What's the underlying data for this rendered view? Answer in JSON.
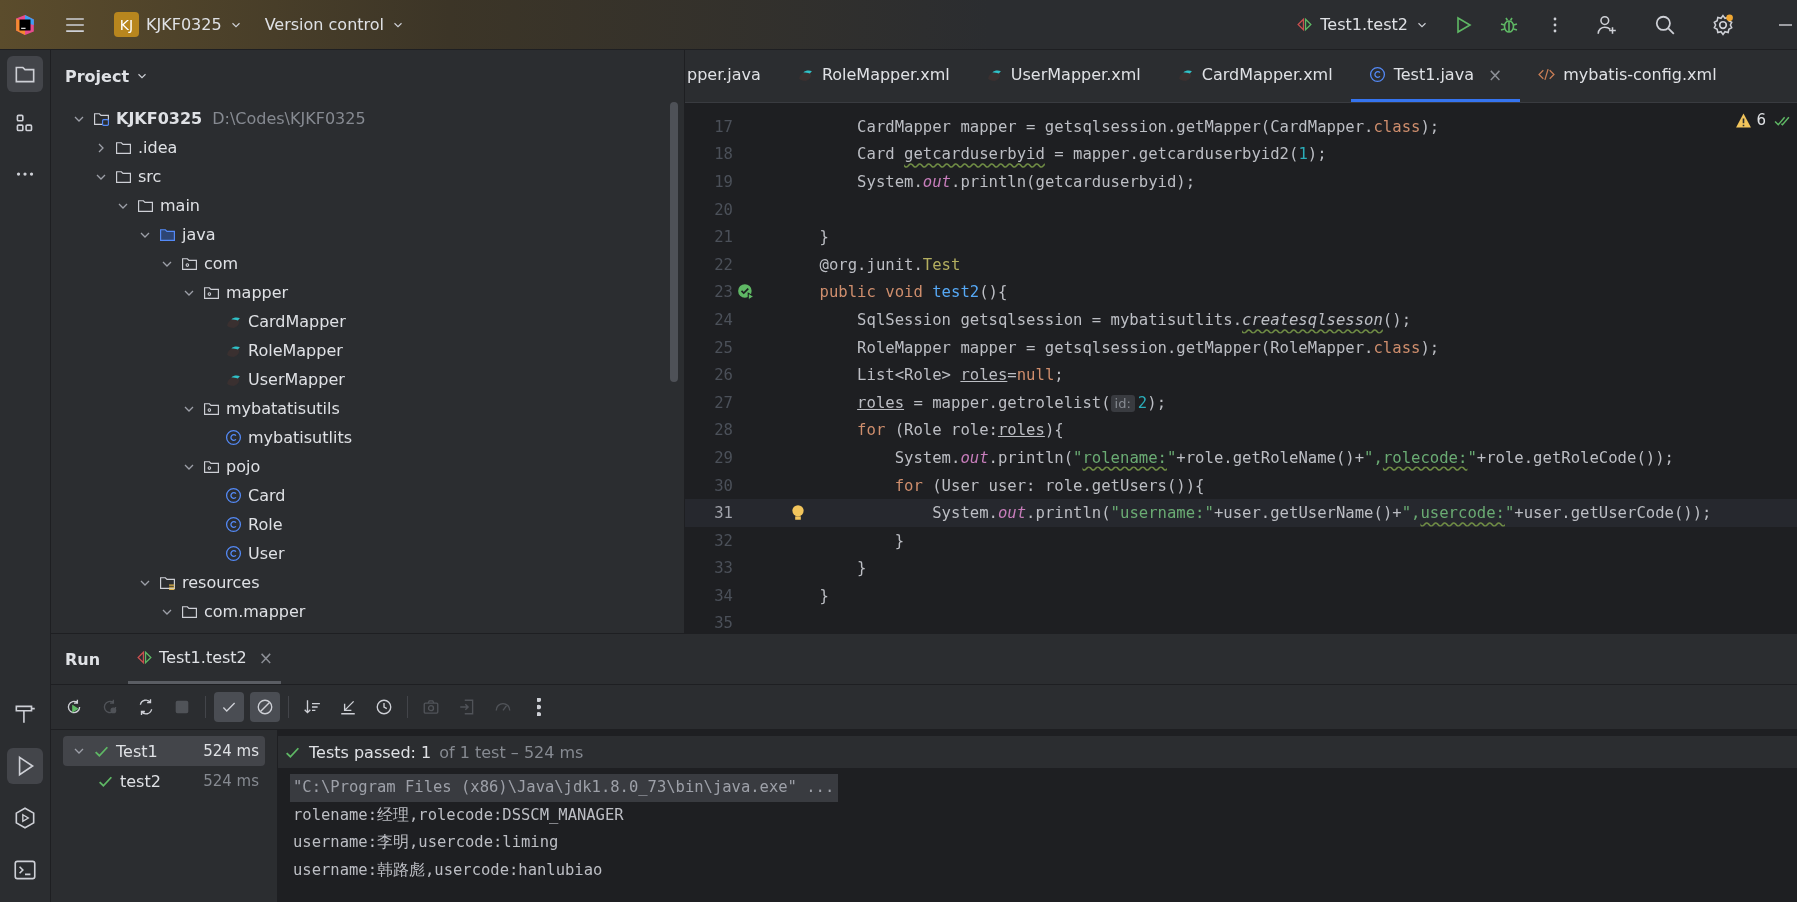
{
  "title_bar": {
    "project_badge": "KJ",
    "project": "KJKF0325",
    "vcs": "Version control",
    "run_config": "Test1.test2"
  },
  "project_panel": {
    "title": "Project",
    "tree": [
      {
        "label": "KJKF0325",
        "path": "D:\\Codes\\KJKF0325",
        "kind": "module",
        "expanded": true,
        "children": [
          {
            "label": ".idea",
            "kind": "folder",
            "expanded": false
          },
          {
            "label": "src",
            "kind": "folder",
            "expanded": true,
            "children": [
              {
                "label": "main",
                "kind": "folder",
                "expanded": true,
                "children": [
                  {
                    "label": "java",
                    "kind": "source",
                    "expanded": true,
                    "children": [
                      {
                        "label": "com",
                        "kind": "package",
                        "expanded": true,
                        "children": [
                          {
                            "label": "mapper",
                            "kind": "package",
                            "expanded": true,
                            "children": [
                              {
                                "label": "CardMapper",
                                "kind": "mybatis"
                              },
                              {
                                "label": "RoleMapper",
                                "kind": "mybatis"
                              },
                              {
                                "label": "UserMapper",
                                "kind": "mybatis"
                              }
                            ]
                          },
                          {
                            "label": "mybatatisutils",
                            "kind": "package",
                            "expanded": true,
                            "children": [
                              {
                                "label": "mybatisutlits",
                                "kind": "class"
                              }
                            ]
                          },
                          {
                            "label": "pojo",
                            "kind": "package",
                            "expanded": true,
                            "children": [
                              {
                                "label": "Card",
                                "kind": "class"
                              },
                              {
                                "label": "Role",
                                "kind": "class"
                              },
                              {
                                "label": "User",
                                "kind": "class"
                              }
                            ]
                          }
                        ]
                      }
                    ]
                  },
                  {
                    "label": "resources",
                    "kind": "resources",
                    "expanded": true,
                    "children": [
                      {
                        "label": "com.mapper",
                        "kind": "folder",
                        "expanded": true
                      }
                    ]
                  }
                ]
              }
            ]
          }
        ]
      }
    ]
  },
  "editor": {
    "tabs": [
      {
        "label": "pper.java",
        "selected": false
      },
      {
        "label": "RoleMapper.xml",
        "kind": "mybatis",
        "selected": false
      },
      {
        "label": "UserMapper.xml",
        "kind": "mybatis",
        "selected": false
      },
      {
        "label": "CardMapper.xml",
        "kind": "mybatis",
        "selected": false
      },
      {
        "label": "Test1.java",
        "kind": "class",
        "selected": true,
        "close": "×"
      },
      {
        "label": "mybatis-config.xml",
        "kind": "xml",
        "selected": false
      }
    ],
    "warnings": "6",
    "lines": [
      {
        "num": "17",
        "current": false,
        "segments": [
          {
            "text": "        CardMapper mapper = getsqlsession.getMapper(CardMapper.",
            "kind": "plain"
          },
          {
            "text": "class",
            "kind": "kw"
          },
          {
            "text": ");",
            "kind": "plain"
          }
        ]
      },
      {
        "num": "18",
        "current": false,
        "segments": [
          {
            "text": "        Card ",
            "kind": "plain"
          },
          {
            "text": "getcarduserbyid",
            "kind": "warn"
          },
          {
            "text": " = mapper.getcarduserbyid2(",
            "kind": "plain"
          },
          {
            "text": "1",
            "kind": "num"
          },
          {
            "text": ");",
            "kind": "plain"
          }
        ]
      },
      {
        "num": "19",
        "current": false,
        "segments": [
          {
            "text": "        System.",
            "kind": "plain"
          },
          {
            "text": "out",
            "kind": "field"
          },
          {
            "text": ".println(getcarduserbyid);",
            "kind": "plain"
          }
        ]
      },
      {
        "num": "20",
        "current": false
      },
      {
        "num": "21",
        "current": false,
        "segments": [
          {
            "text": "    }",
            "kind": "plain"
          }
        ]
      },
      {
        "num": "22",
        "current": false,
        "segments": [
          {
            "text": "    @org.junit.",
            "kind": "plain"
          },
          {
            "text": "Test",
            "kind": "ann"
          }
        ]
      },
      {
        "num": "23",
        "current": false,
        "gutter": {
          "kind": "test-passed"
        },
        "segments": [
          {
            "text": "    public void ",
            "kind": "kw"
          },
          {
            "text": "test2",
            "kind": "fn"
          },
          {
            "text": "(){",
            "kind": "plain"
          }
        ]
      },
      {
        "num": "24",
        "current": false,
        "segments": [
          {
            "text": "        SqlSession getsqlsession = mybatisutlits.",
            "kind": "plain"
          },
          {
            "text": "createsqlsesson",
            "kind": "static"
          },
          {
            "text": "();",
            "kind": "plain"
          }
        ]
      },
      {
        "num": "25",
        "current": false,
        "segments": [
          {
            "text": "        RoleMapper mapper = getsqlsession.getMapper(RoleMapper.",
            "kind": "plain"
          },
          {
            "text": "class",
            "kind": "kw"
          },
          {
            "text": ");",
            "kind": "plain"
          }
        ]
      },
      {
        "num": "26",
        "current": false,
        "segments": [
          {
            "text": "        List<Role> ",
            "kind": "plain"
          },
          {
            "text": "roles",
            "kind": "under"
          },
          {
            "text": "=",
            "kind": "plain"
          },
          {
            "text": "null",
            "kind": "kw"
          },
          {
            "text": ";",
            "kind": "plain"
          }
        ]
      },
      {
        "num": "27",
        "current": false,
        "segments": [
          {
            "text": "        roles",
            "kind": "under"
          },
          {
            "text": " = mapper.getrolelist(",
            "kind": "plain"
          },
          {
            "text": "id:",
            "kind": "hint"
          },
          {
            "text": "2",
            "kind": "num"
          },
          {
            "text": ");",
            "kind": "plain"
          }
        ]
      },
      {
        "num": "28",
        "current": false,
        "segments": [
          {
            "text": "        for",
            "kind": "kw"
          },
          {
            "text": " (Role role:",
            "kind": "plain"
          },
          {
            "text": "roles",
            "kind": "under"
          },
          {
            "text": "){",
            "kind": "plain"
          }
        ]
      },
      {
        "num": "29",
        "current": false,
        "segments": [
          {
            "text": "            System.",
            "kind": "plain"
          },
          {
            "text": "out",
            "kind": "field"
          },
          {
            "text": ".println(",
            "kind": "plain"
          },
          {
            "text": "\"",
            "kind": "str"
          },
          {
            "text": "rolename:",
            "kind": "strwarn"
          },
          {
            "text": "\"",
            "kind": "str"
          },
          {
            "text": "+role.getRoleName()+",
            "kind": "plain"
          },
          {
            "text": "\",",
            "kind": "str"
          },
          {
            "text": "rolecode:",
            "kind": "strwarn"
          },
          {
            "text": "\"",
            "kind": "str"
          },
          {
            "text": "+role.getRoleCode());",
            "kind": "plain"
          }
        ]
      },
      {
        "num": "30",
        "current": false,
        "segments": [
          {
            "text": "            for",
            "kind": "kw"
          },
          {
            "text": " (User user: role.getUsers()){",
            "kind": "plain"
          }
        ]
      },
      {
        "num": "31",
        "current": true,
        "gutter": {
          "kind": "bulb"
        },
        "segments": [
          {
            "text": "                System.",
            "kind": "plain"
          },
          {
            "text": "out",
            "kind": "field"
          },
          {
            "text": ".println(",
            "kind": "plain"
          },
          {
            "text": "\"username:\"",
            "kind": "str"
          },
          {
            "text": "+user.getUserName()+",
            "kind": "plain"
          },
          {
            "text": "\",",
            "kind": "str"
          },
          {
            "text": "usercode:",
            "kind": "strwarn"
          },
          {
            "text": "\"",
            "kind": "str"
          },
          {
            "text": "+user.getUserCode());",
            "kind": "plain"
          }
        ]
      },
      {
        "num": "32",
        "current": false,
        "segments": [
          {
            "text": "            }",
            "kind": "plain"
          }
        ]
      },
      {
        "num": "33",
        "current": false,
        "segments": [
          {
            "text": "        }",
            "kind": "plain"
          }
        ]
      },
      {
        "num": "34",
        "current": false,
        "segments": [
          {
            "text": "    }",
            "kind": "plain"
          }
        ]
      },
      {
        "num": "35",
        "current": false
      }
    ]
  },
  "run_panel": {
    "title": "Run",
    "tab": {
      "label": "Test1.test2",
      "close": "×",
      "selected": true
    },
    "toolbar": [
      {
        "kind": "rerun",
        "disabled": false,
        "selected": false
      },
      {
        "kind": "rerun-failed",
        "disabled": true,
        "selected": false
      },
      {
        "kind": "toggle-auto",
        "disabled": false,
        "selected": false
      },
      {
        "kind": "stop",
        "disabled": true,
        "selected": false
      },
      {
        "kind": "check",
        "disabled": false,
        "selected": true
      },
      {
        "kind": "ignore",
        "disabled": false,
        "selected": true
      },
      {
        "kind": "sort",
        "disabled": false,
        "selected": false
      },
      {
        "kind": "collapse",
        "disabled": false,
        "selected": false
      },
      {
        "kind": "history",
        "disabled": false,
        "selected": false
      },
      {
        "kind": "camera",
        "disabled": true,
        "selected": false
      },
      {
        "kind": "import",
        "disabled": true,
        "selected": false
      },
      {
        "kind": "gauge",
        "disabled": true,
        "selected": false
      },
      {
        "kind": "more",
        "disabled": false,
        "selected": false
      }
    ],
    "tests": [
      {
        "label": "Test1",
        "time": "524 ms",
        "selected": true,
        "passed": true,
        "children": [
          {
            "label": "test2",
            "time": "524 ms",
            "selected": false,
            "passed": true
          }
        ]
      }
    ],
    "summary": {
      "main": "Tests passed: 1",
      "detail": "of 1 test – 524 ms"
    },
    "console": [
      {
        "text": "\"C:\\Program Files (x86)\\Java\\jdk1.8.0_73\\bin\\java.exe\" ...",
        "kind": "command"
      },
      {
        "text": "rolename:经理,rolecode:DSSCM_MANAGER",
        "kind": "output"
      },
      {
        "text": "username:李明,usercode:liming",
        "kind": "output"
      },
      {
        "text": "username:韩路彪,usercode:hanlubiao",
        "kind": "output"
      }
    ]
  }
}
